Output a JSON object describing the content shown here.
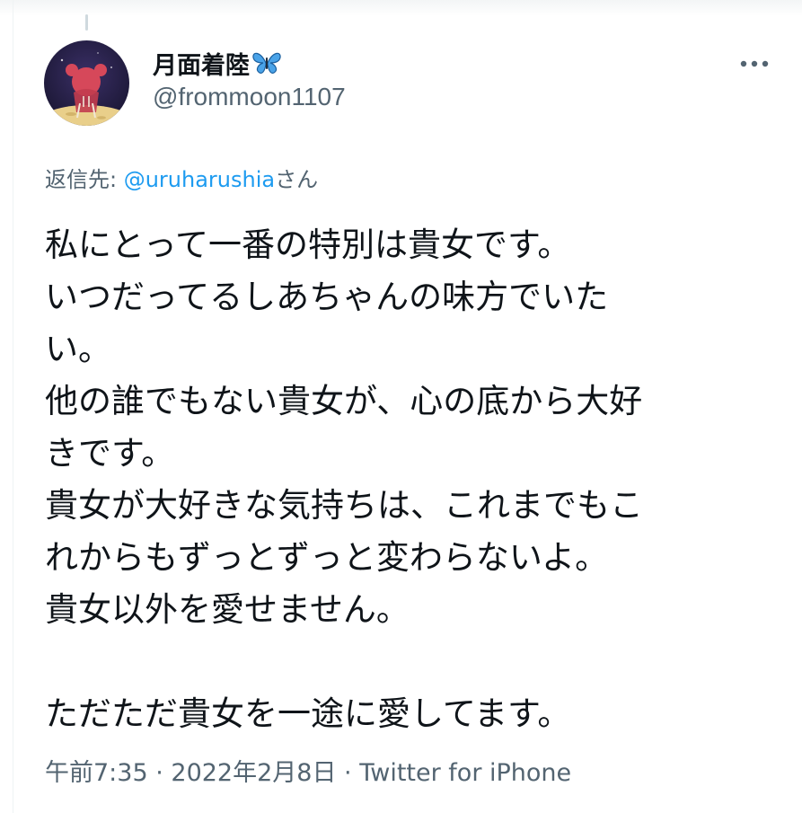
{
  "author": {
    "display_name": "月面着陸",
    "handle": "@frommoon1107",
    "badge_icon": "butterfly-emoji-icon"
  },
  "reply": {
    "prefix": "返信先: ",
    "mention": "@uruharushia",
    "suffix": "さん"
  },
  "tweet": {
    "lines": [
      "私にとって一番の特別は貴女です。",
      "いつだってるしあちゃんの味方でいた",
      "い。",
      "他の誰でもない貴女が、心の底から大好",
      "きです。",
      "貴女が大好きな気持ちは、これまでもこ",
      "れからもずっとずっと変わらないよ。",
      "貴女以外を愛せません。",
      "",
      "ただただ貴女を一途に愛してます。"
    ]
  },
  "meta": {
    "time": "午前7:35",
    "separator": " · ",
    "date": "2022年2月8日",
    "source": "Twitter for iPhone"
  },
  "colors": {
    "primary_text": "#0f1419",
    "secondary_text": "#536471",
    "link": "#1d9bf0",
    "butterfly": "#4aa3e8"
  }
}
